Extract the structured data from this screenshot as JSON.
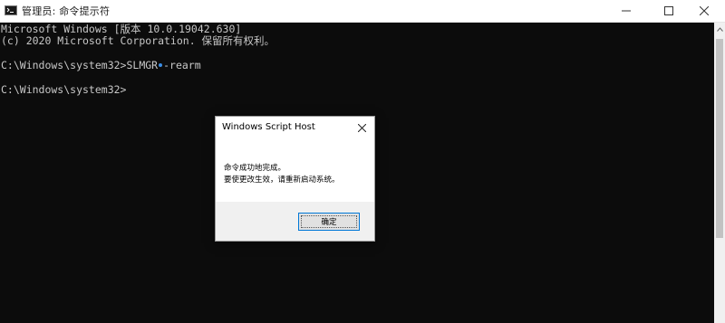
{
  "window": {
    "title": "管理员: 命令提示符",
    "icon": "cmd-icon",
    "controls": {
      "minimize": "minimize-icon",
      "maximize": "maximize-icon",
      "close": "close-icon"
    }
  },
  "console": {
    "lines": [
      "Microsoft Windows [版本 10.0.19042.630]",
      "(c) 2020 Microsoft Corporation. 保留所有权利。",
      "C:\\Windows\\system32>SLMGR",
      "-rearm",
      "C:\\Windows\\system32>"
    ],
    "colors": {
      "background": "#0c0c0c",
      "text": "#c7c7c7"
    }
  },
  "dialog": {
    "title": "Windows Script Host",
    "message_line1": "命令成功地完成。",
    "message_line2": "要使更改生效，请重新启动系统。",
    "ok_label": "确定",
    "accent": "#0078d7"
  }
}
